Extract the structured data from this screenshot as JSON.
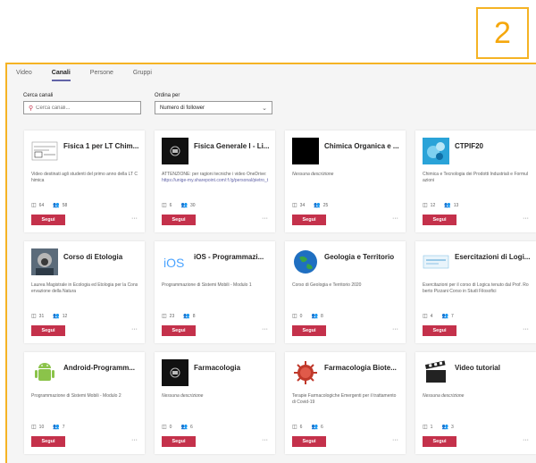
{
  "callout": {
    "number": "2",
    "color": "#f5b324"
  },
  "tabs": [
    {
      "label": "Video",
      "active": false
    },
    {
      "label": "Canali",
      "active": true
    },
    {
      "label": "Persone",
      "active": false
    },
    {
      "label": "Gruppi",
      "active": false
    }
  ],
  "filters": {
    "search_label": "Cerca canali",
    "search_placeholder": "Cerca canali...",
    "sort_label": "Ordina per",
    "sort_value": "Numero di follower"
  },
  "accent": "#c4314b",
  "channels": [
    {
      "title": "Fisica 1 per LT Chim...",
      "description": "Video destinati agli studenti del primo anno della LT Chimica",
      "link": "",
      "videos": "64",
      "followers": "58",
      "button": "Segui",
      "thumb_icon": "document-thumb-icon"
    },
    {
      "title": "Fisica Generale I - Li...",
      "description": "ATTENZIONE: per ragioni tecniche i video OneDrive: ",
      "link": "https://unige-my.sharepoint.com/:f:/g/personal/pietro_t",
      "videos": "6",
      "followers": "30",
      "button": "Segui",
      "thumb_icon": "teams-thumb-icon"
    },
    {
      "title": "Chimica Organica e ...",
      "description": "Nessuna descrizione",
      "link": "",
      "videos": "34",
      "followers": "25",
      "button": "Segui",
      "thumb_icon": "black-thumb-icon",
      "italic": true
    },
    {
      "title": "CTPIF20",
      "description": "Chimica e Tecnologia dei Prodotti Industriali e Formulazioni",
      "link": "",
      "videos": "12",
      "followers": "13",
      "button": "Segui",
      "thumb_icon": "molecule-thumb-icon"
    },
    {
      "title": "Corso di Etologia",
      "description": "Laurea Magistrale in Ecologia ed Etologia per la Conservazione della Natura",
      "link": "",
      "videos": "31",
      "followers": "12",
      "button": "Segui",
      "thumb_icon": "primate-thumb-icon"
    },
    {
      "title": "iOS - Programmazi...",
      "description": "Programmazione di Sistemi Mobili - Modulo 1",
      "link": "",
      "videos": "23",
      "followers": "8",
      "button": "Segui",
      "thumb_icon": "ios-thumb-icon"
    },
    {
      "title": "Geologia e Territorio",
      "description": "Corso di Geologia e Territorio 2020",
      "link": "",
      "videos": "0",
      "followers": "8",
      "button": "Segui",
      "thumb_icon": "globe-thumb-icon"
    },
    {
      "title": "Esercitazioni di Logi...",
      "description": "Esercitazioni per il corso di Logica tenuto dal Prof. Roberto Pizzani Corso in Studi Filosofici",
      "link": "",
      "videos": "4",
      "followers": "7",
      "button": "Segui",
      "thumb_icon": "slide-thumb-icon"
    },
    {
      "title": "Android-Programm...",
      "description": "Programmazione di Sistemi Mobili - Modulo 2",
      "link": "",
      "videos": "10",
      "followers": "7",
      "button": "Segui",
      "thumb_icon": "android-thumb-icon"
    },
    {
      "title": "Farmacologia",
      "description": "Nessuna descrizione",
      "link": "",
      "videos": "0",
      "followers": "6",
      "button": "Segui",
      "thumb_icon": "teams-thumb-icon",
      "italic": true
    },
    {
      "title": "Farmacologia Biote...",
      "description": "Terapie Farmacologiche Emergenti per il trattamento di Covid-19",
      "link": "",
      "videos": "6",
      "followers": "6",
      "button": "Segui",
      "thumb_icon": "virus-thumb-icon"
    },
    {
      "title": "Video tutorial",
      "description": "Nessuna descrizione",
      "link": "",
      "videos": "1",
      "followers": "3",
      "button": "Segui",
      "thumb_icon": "clapperboard-thumb-icon",
      "italic": true
    }
  ]
}
